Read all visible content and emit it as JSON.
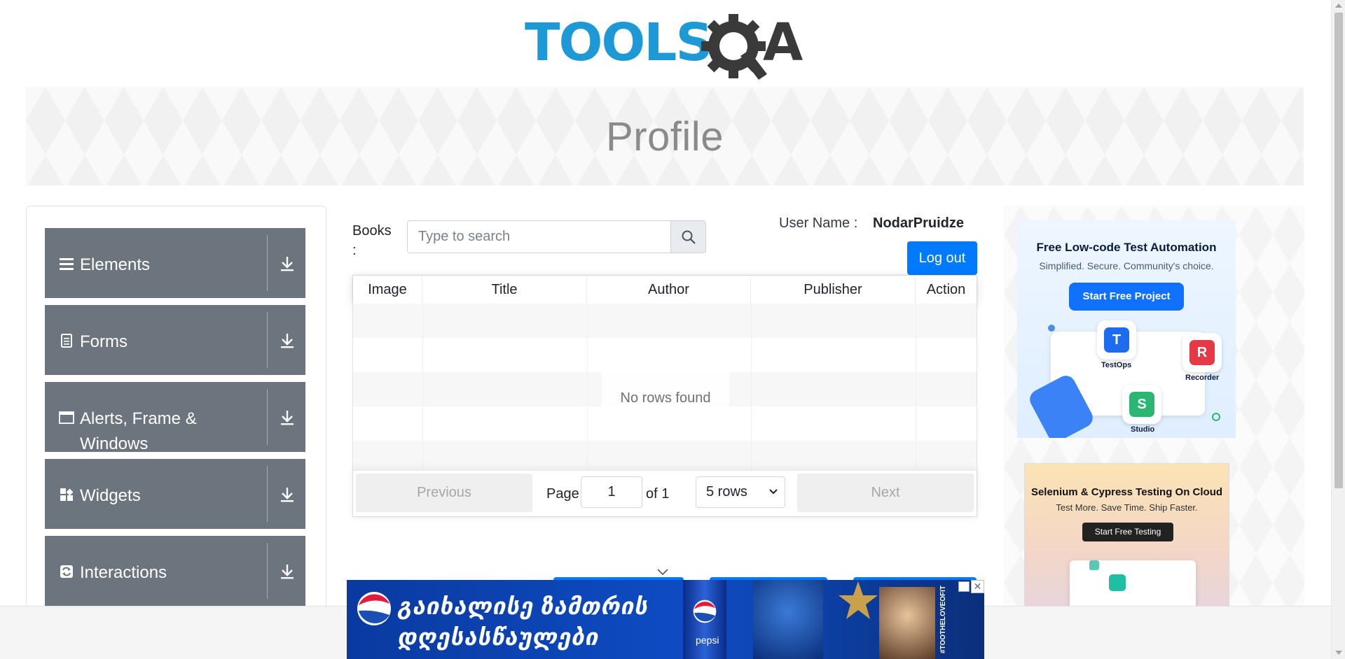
{
  "header": {
    "logo_text": "TOOLSQA",
    "page_title": "Profile"
  },
  "sidebar": {
    "groups": [
      {
        "label": "Elements",
        "icon": "hamburger-icon"
      },
      {
        "label": "Forms",
        "icon": "document-icon"
      },
      {
        "label": "Alerts, Frame & Windows",
        "icon": "window-icon"
      },
      {
        "label": "Widgets",
        "icon": "widgets-icon"
      },
      {
        "label": "Interactions",
        "icon": "refresh-icon"
      }
    ],
    "expand_icon": "download-arrow-icon"
  },
  "profile": {
    "books_label": "Books :",
    "search_placeholder": "Type to search",
    "user_name_label": "User Name :",
    "user_name_value": "NodarPruidze",
    "logout_label": "Log out"
  },
  "table": {
    "columns": [
      "Image",
      "Title",
      "Author",
      "Publisher",
      "Action"
    ],
    "rows": [],
    "empty_text": "No rows found",
    "pagination": {
      "previous_label": "Previous",
      "next_label": "Next",
      "page_label": "Page",
      "page_value": "1",
      "of_label": "of 1",
      "rows_option": "5 rows"
    }
  },
  "ads": {
    "katalon": {
      "headline": "Free Low-code Test Automation",
      "subline": "Simplified. Secure. Community's choice.",
      "cta": "Start Free Project",
      "products": [
        "TestOps",
        "Recorder",
        "Studio"
      ]
    },
    "cloud": {
      "headline": "Selenium & Cypress Testing On Cloud",
      "subline": "Test More. Save Time. Ship Faster.",
      "cta": "Start Free Testing"
    },
    "bottom": {
      "line1": "გაიხალისე ზამთრის",
      "line2": "დღესასწაულები",
      "brand": "pepsi",
      "vertical_text": "#TOOTHELOVEOFIT",
      "close_label": "✕"
    }
  },
  "colors": {
    "primary": "#007bff",
    "sidebar_group": "#6c757d",
    "logo_blue": "#1d9ad6",
    "logo_dark": "#3a3a3a"
  }
}
